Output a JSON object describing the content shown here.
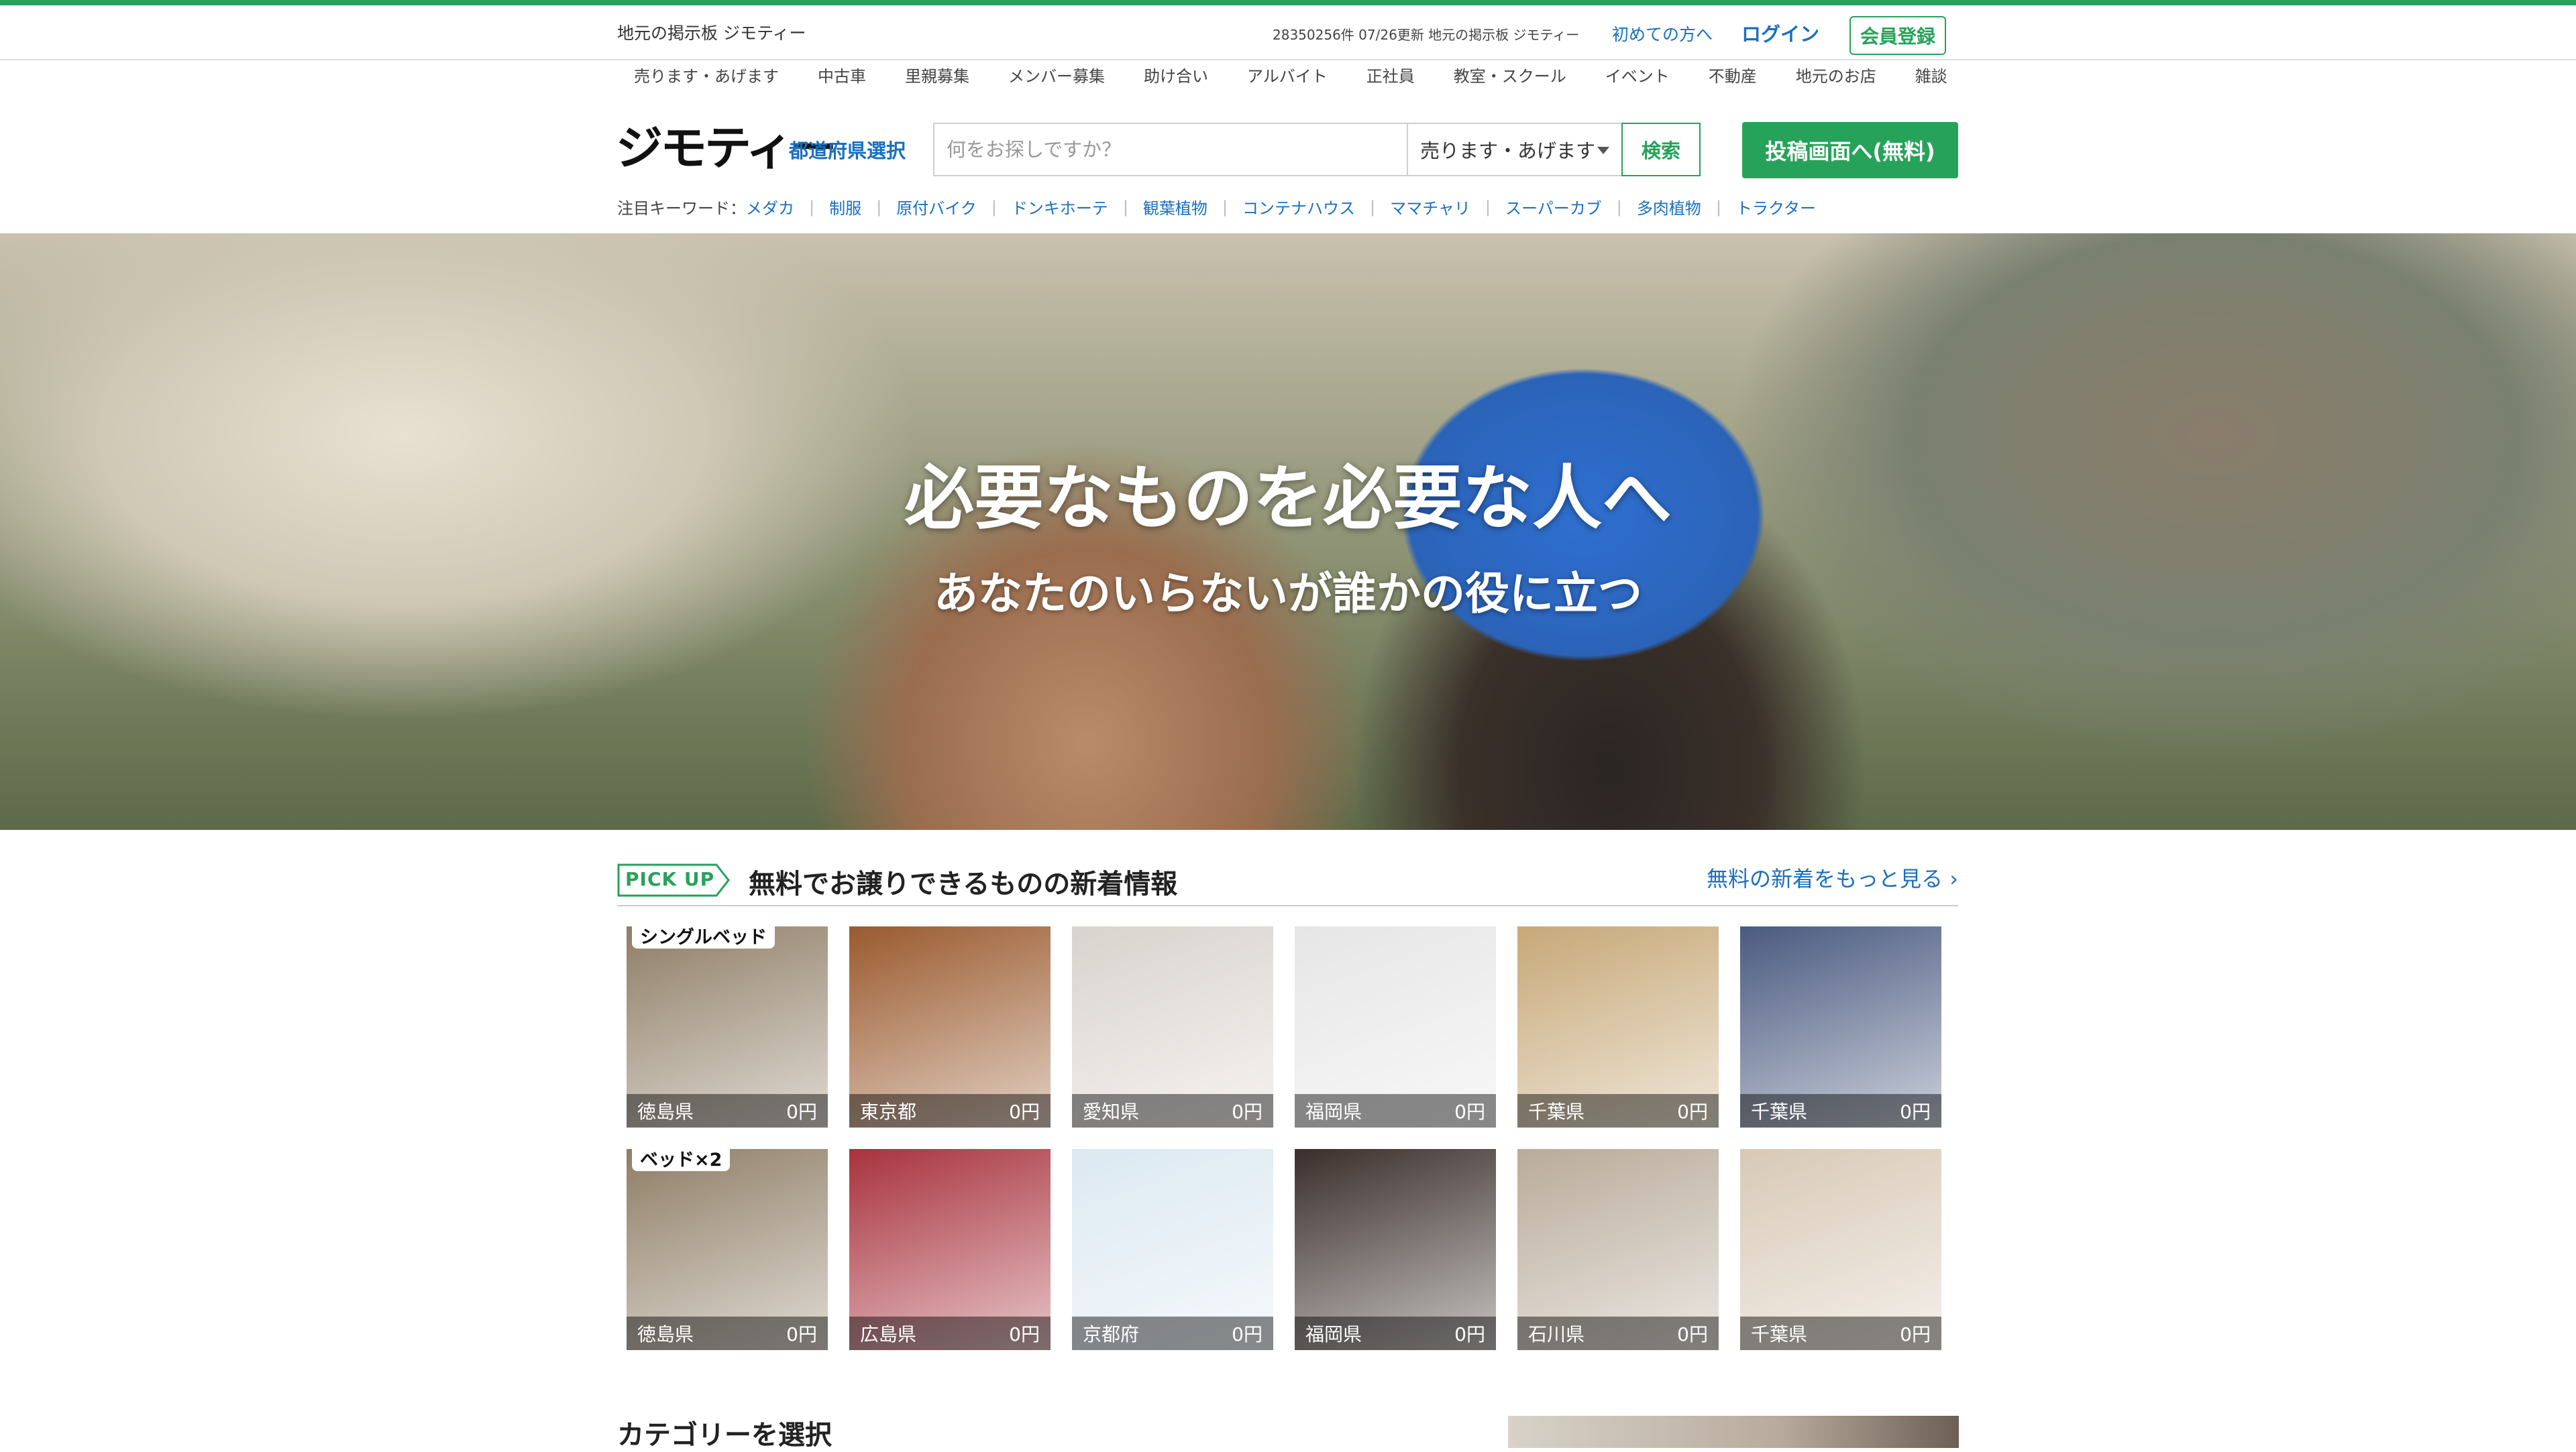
{
  "header": {
    "site_tag": "地元の掲示板 ジモティー",
    "count_text": "28350256件 07/26更新 地元の掲示板 ジモティー",
    "first_time": "初めての方へ",
    "login": "ログイン",
    "register": "会員登録"
  },
  "categories": [
    "売ります・あげます",
    "中古車",
    "里親募集",
    "メンバー募集",
    "助け合い",
    "アルバイト",
    "正社員",
    "教室・スクール",
    "イベント",
    "不動産",
    "地元のお店",
    "雑談"
  ],
  "logo": {
    "text": "ジモティー"
  },
  "prefecture_select": "都道府県選択",
  "search": {
    "placeholder": "何をお探しですか？",
    "value": ""
  },
  "search_category": {
    "selected": "売ります・あげます"
  },
  "search_button": "検索",
  "post_button": "投稿画面へ(無料)",
  "keywords": {
    "label": "注目キーワード：",
    "items": [
      "メダカ",
      "制服",
      "原付バイク",
      "ドンキホーテ",
      "観葉植物",
      "コンテナハウス",
      "ママチャリ",
      "スーパーカブ",
      "多肉植物",
      "トラクター"
    ]
  },
  "hero": {
    "title": "必要なものを必要な人へ",
    "subtitle": "あなたのいらないが誰かの役に立つ"
  },
  "pickup": {
    "badge": "PICK UP",
    "title": "無料でお譲りできるものの新着情報",
    "more": "無料の新着をもっと見る ›"
  },
  "items": [
    {
      "pref": "徳島県",
      "price": "0円",
      "tag": "シングルベッド",
      "color": "#8f7e66"
    },
    {
      "pref": "東京都",
      "price": "0円",
      "tag": "",
      "color": "#9a5a2e"
    },
    {
      "pref": "愛知県",
      "price": "0円",
      "tag": "",
      "color": "#d9d3cd"
    },
    {
      "pref": "福岡県",
      "price": "0円",
      "tag": "",
      "color": "#e6e6e6"
    },
    {
      "pref": "千葉県",
      "price": "0円",
      "tag": "",
      "color": "#c7a878"
    },
    {
      "pref": "千葉県",
      "price": "0円",
      "tag": "",
      "color": "#4a5a80"
    },
    {
      "pref": "徳島県",
      "price": "0円",
      "tag": "ベッド×2",
      "color": "#8f7e66"
    },
    {
      "pref": "広島県",
      "price": "0円",
      "tag": "",
      "color": "#a8323d"
    },
    {
      "pref": "京都府",
      "price": "0円",
      "tag": "",
      "color": "#dce9f2"
    },
    {
      "pref": "福岡県",
      "price": "0円",
      "tag": "",
      "color": "#3a2e2a"
    },
    {
      "pref": "石川県",
      "price": "0円",
      "tag": "",
      "color": "#b9ab9a"
    },
    {
      "pref": "千葉県",
      "price": "0円",
      "tag": "",
      "color": "#d8c9b6"
    }
  ],
  "category_section": {
    "title": "カテゴリーを選択"
  }
}
